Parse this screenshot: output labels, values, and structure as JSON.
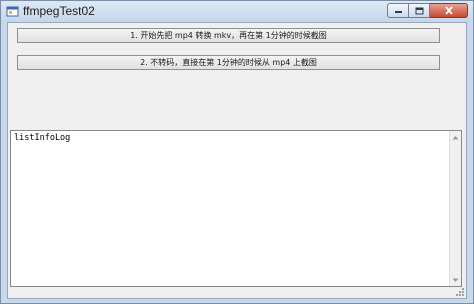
{
  "window": {
    "title": "ffmpegTest02"
  },
  "buttons": {
    "btn1_label": "1. 开始先把 mp4 转换 mkv，再在第 1分钟的时候截图",
    "btn2_label": "2. 不转码，直接在第 1分钟的时候从 mp4 上截图"
  },
  "log": {
    "items": [
      "listInfoLog"
    ]
  },
  "icons": {
    "app": "app-window-icon",
    "minimize": "minimize-icon",
    "maximize": "maximize-icon",
    "close": "close-icon",
    "scroll_up": "scroll-up-arrow-icon",
    "scroll_down": "scroll-down-arrow-icon",
    "grip": "resize-grip-icon"
  },
  "colors": {
    "close_button": "#c64a34",
    "titlebar": "#c9d9ec",
    "client_bg": "#f0f0f0"
  }
}
